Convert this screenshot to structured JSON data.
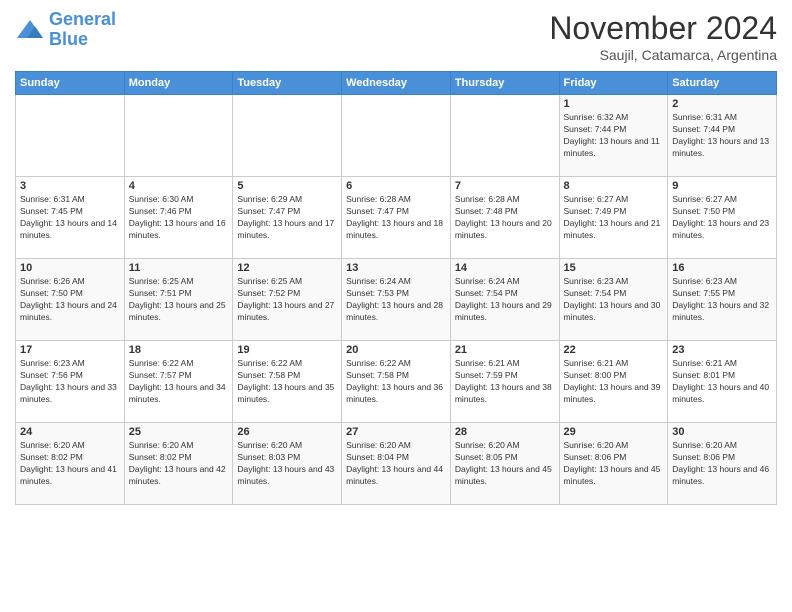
{
  "header": {
    "logo_line1": "General",
    "logo_line2": "Blue",
    "month": "November 2024",
    "location": "Saujil, Catamarca, Argentina"
  },
  "weekdays": [
    "Sunday",
    "Monday",
    "Tuesday",
    "Wednesday",
    "Thursday",
    "Friday",
    "Saturday"
  ],
  "weeks": [
    [
      {
        "day": "",
        "info": ""
      },
      {
        "day": "",
        "info": ""
      },
      {
        "day": "",
        "info": ""
      },
      {
        "day": "",
        "info": ""
      },
      {
        "day": "",
        "info": ""
      },
      {
        "day": "1",
        "info": "Sunrise: 6:32 AM\nSunset: 7:44 PM\nDaylight: 13 hours and 11 minutes."
      },
      {
        "day": "2",
        "info": "Sunrise: 6:31 AM\nSunset: 7:44 PM\nDaylight: 13 hours and 13 minutes."
      }
    ],
    [
      {
        "day": "3",
        "info": "Sunrise: 6:31 AM\nSunset: 7:45 PM\nDaylight: 13 hours and 14 minutes."
      },
      {
        "day": "4",
        "info": "Sunrise: 6:30 AM\nSunset: 7:46 PM\nDaylight: 13 hours and 16 minutes."
      },
      {
        "day": "5",
        "info": "Sunrise: 6:29 AM\nSunset: 7:47 PM\nDaylight: 13 hours and 17 minutes."
      },
      {
        "day": "6",
        "info": "Sunrise: 6:28 AM\nSunset: 7:47 PM\nDaylight: 13 hours and 18 minutes."
      },
      {
        "day": "7",
        "info": "Sunrise: 6:28 AM\nSunset: 7:48 PM\nDaylight: 13 hours and 20 minutes."
      },
      {
        "day": "8",
        "info": "Sunrise: 6:27 AM\nSunset: 7:49 PM\nDaylight: 13 hours and 21 minutes."
      },
      {
        "day": "9",
        "info": "Sunrise: 6:27 AM\nSunset: 7:50 PM\nDaylight: 13 hours and 23 minutes."
      }
    ],
    [
      {
        "day": "10",
        "info": "Sunrise: 6:26 AM\nSunset: 7:50 PM\nDaylight: 13 hours and 24 minutes."
      },
      {
        "day": "11",
        "info": "Sunrise: 6:25 AM\nSunset: 7:51 PM\nDaylight: 13 hours and 25 minutes."
      },
      {
        "day": "12",
        "info": "Sunrise: 6:25 AM\nSunset: 7:52 PM\nDaylight: 13 hours and 27 minutes."
      },
      {
        "day": "13",
        "info": "Sunrise: 6:24 AM\nSunset: 7:53 PM\nDaylight: 13 hours and 28 minutes."
      },
      {
        "day": "14",
        "info": "Sunrise: 6:24 AM\nSunset: 7:54 PM\nDaylight: 13 hours and 29 minutes."
      },
      {
        "day": "15",
        "info": "Sunrise: 6:23 AM\nSunset: 7:54 PM\nDaylight: 13 hours and 30 minutes."
      },
      {
        "day": "16",
        "info": "Sunrise: 6:23 AM\nSunset: 7:55 PM\nDaylight: 13 hours and 32 minutes."
      }
    ],
    [
      {
        "day": "17",
        "info": "Sunrise: 6:23 AM\nSunset: 7:56 PM\nDaylight: 13 hours and 33 minutes."
      },
      {
        "day": "18",
        "info": "Sunrise: 6:22 AM\nSunset: 7:57 PM\nDaylight: 13 hours and 34 minutes."
      },
      {
        "day": "19",
        "info": "Sunrise: 6:22 AM\nSunset: 7:58 PM\nDaylight: 13 hours and 35 minutes."
      },
      {
        "day": "20",
        "info": "Sunrise: 6:22 AM\nSunset: 7:58 PM\nDaylight: 13 hours and 36 minutes."
      },
      {
        "day": "21",
        "info": "Sunrise: 6:21 AM\nSunset: 7:59 PM\nDaylight: 13 hours and 38 minutes."
      },
      {
        "day": "22",
        "info": "Sunrise: 6:21 AM\nSunset: 8:00 PM\nDaylight: 13 hours and 39 minutes."
      },
      {
        "day": "23",
        "info": "Sunrise: 6:21 AM\nSunset: 8:01 PM\nDaylight: 13 hours and 40 minutes."
      }
    ],
    [
      {
        "day": "24",
        "info": "Sunrise: 6:20 AM\nSunset: 8:02 PM\nDaylight: 13 hours and 41 minutes."
      },
      {
        "day": "25",
        "info": "Sunrise: 6:20 AM\nSunset: 8:02 PM\nDaylight: 13 hours and 42 minutes."
      },
      {
        "day": "26",
        "info": "Sunrise: 6:20 AM\nSunset: 8:03 PM\nDaylight: 13 hours and 43 minutes."
      },
      {
        "day": "27",
        "info": "Sunrise: 6:20 AM\nSunset: 8:04 PM\nDaylight: 13 hours and 44 minutes."
      },
      {
        "day": "28",
        "info": "Sunrise: 6:20 AM\nSunset: 8:05 PM\nDaylight: 13 hours and 45 minutes."
      },
      {
        "day": "29",
        "info": "Sunrise: 6:20 AM\nSunset: 8:06 PM\nDaylight: 13 hours and 45 minutes."
      },
      {
        "day": "30",
        "info": "Sunrise: 6:20 AM\nSunset: 8:06 PM\nDaylight: 13 hours and 46 minutes."
      }
    ]
  ]
}
